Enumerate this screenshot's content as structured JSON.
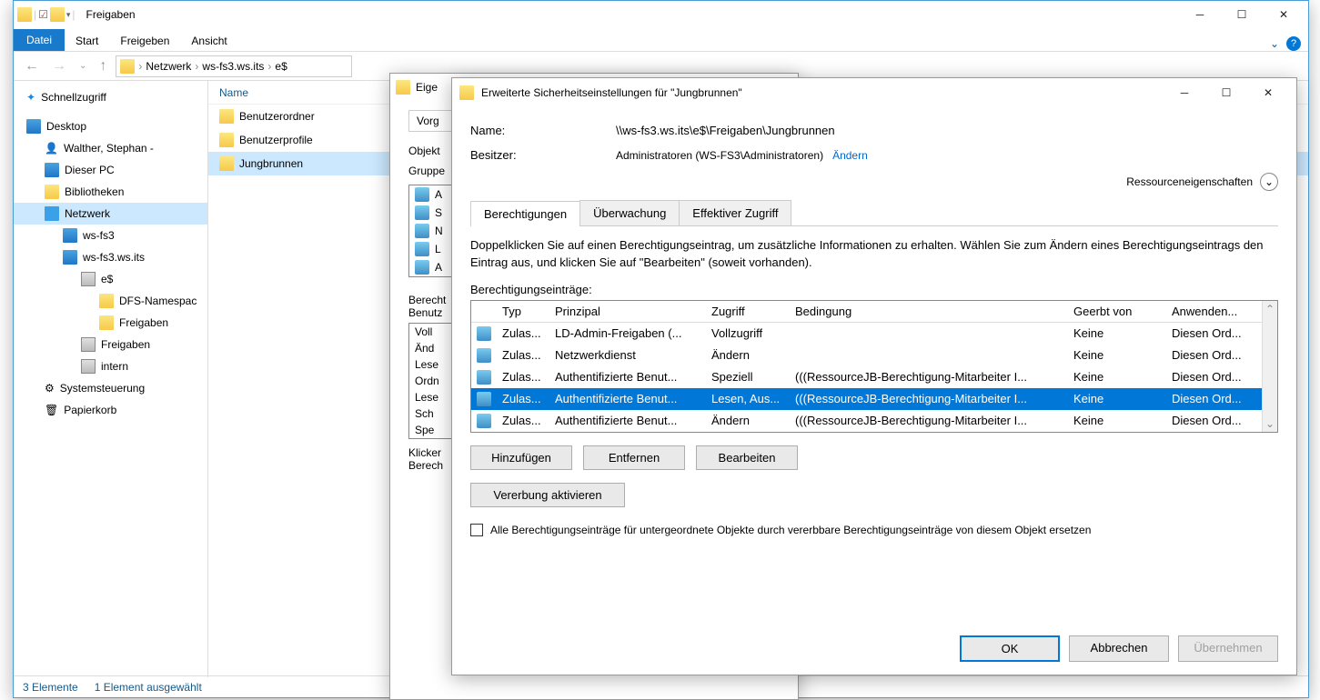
{
  "explorer": {
    "title": "Freigaben",
    "ribbon": {
      "file": "Datei",
      "tabs": [
        "Start",
        "Freigeben",
        "Ansicht"
      ]
    },
    "breadcrumb": [
      "Netzwerk",
      "ws-fs3.ws.its",
      "e$"
    ],
    "tree": {
      "quick": "Schnellzugriff",
      "desktop": "Desktop",
      "user": "Walther, Stephan - ",
      "thispc": "Dieser PC",
      "libs": "Bibliotheken",
      "network": "Netzwerk",
      "host1": "ws-fs3",
      "host2": "ws-fs3.ws.its",
      "share": "e$",
      "dfs": "DFS-Namespac",
      "freigaben1": "Freigaben",
      "freigaben2": "Freigaben",
      "intern": "intern",
      "control": "Systemsteuerung",
      "recycle": "Papierkorb"
    },
    "list_header": "Name",
    "list_items": [
      "Benutzerordner",
      "Benutzerprofile",
      "Jungbrunnen"
    ],
    "status": {
      "count": "3 Elemente",
      "selected": "1 Element ausgewählt"
    }
  },
  "props": {
    "title": "Eige",
    "prev": "Vorg",
    "obj": "Objekt",
    "grp": "Gruppe",
    "perm": "Berecht",
    "user": "Benutz",
    "list": [
      "Voll",
      "Änd",
      "Lese",
      "Ordn",
      "Lese",
      "Sch",
      "Spe"
    ],
    "klick": "Klicker",
    "berech": "Berech"
  },
  "adv": {
    "title": "Erweiterte Sicherheitseinstellungen für \"Jungbrunnen\"",
    "name_label": "Name:",
    "name_value": "\\\\ws-fs3.ws.its\\e$\\Freigaben\\Jungbrunnen",
    "owner_label": "Besitzer:",
    "owner_value": "Administratoren (WS-FS3\\Administratoren)",
    "change": "Ändern",
    "resource": "Ressourceneigenschaften",
    "tabs": [
      "Berechtigungen",
      "Überwachung",
      "Effektiver Zugriff"
    ],
    "hint": "Doppelklicken Sie auf einen Berechtigungseintrag, um zusätzliche Informationen zu erhalten. Wählen Sie zum Ändern eines Berechtigungseintrags den Eintrag aus, und klicken Sie auf \"Bearbeiten\" (soweit vorhanden).",
    "entries_label": "Berechtigungseinträge:",
    "columns": {
      "type": "Typ",
      "principal": "Prinzipal",
      "access": "Zugriff",
      "condition": "Bedingung",
      "inherited": "Geerbt von",
      "apply": "Anwenden..."
    },
    "rows": [
      {
        "type": "Zulas...",
        "principal": "LD-Admin-Freigaben (...",
        "access": "Vollzugriff",
        "condition": "",
        "inherited": "Keine",
        "apply": "Diesen Ord..."
      },
      {
        "type": "Zulas...",
        "principal": "Netzwerkdienst",
        "access": "Ändern",
        "condition": "",
        "inherited": "Keine",
        "apply": "Diesen Ord..."
      },
      {
        "type": "Zulas...",
        "principal": "Authentifizierte Benut...",
        "access": "Speziell",
        "condition": "(((RessourceJB-Berechtigung-Mitarbeiter I...",
        "inherited": "Keine",
        "apply": "Diesen Ord..."
      },
      {
        "type": "Zulas...",
        "principal": "Authentifizierte Benut...",
        "access": "Lesen, Aus...",
        "condition": "(((RessourceJB-Berechtigung-Mitarbeiter I...",
        "inherited": "Keine",
        "apply": "Diesen Ord..."
      },
      {
        "type": "Zulas...",
        "principal": "Authentifizierte Benut...",
        "access": "Ändern",
        "condition": "(((RessourceJB-Berechtigung-Mitarbeiter I...",
        "inherited": "Keine",
        "apply": "Diesen Ord..."
      }
    ],
    "buttons": {
      "add": "Hinzufügen",
      "remove": "Entfernen",
      "edit": "Bearbeiten",
      "inherit": "Vererbung aktivieren"
    },
    "replace": "Alle Berechtigungseinträge für untergeordnete Objekte durch vererbbare Berechtigungseinträge von diesem Objekt ersetzen",
    "ok": "OK",
    "cancel": "Abbrechen",
    "apply": "Übernehmen"
  }
}
